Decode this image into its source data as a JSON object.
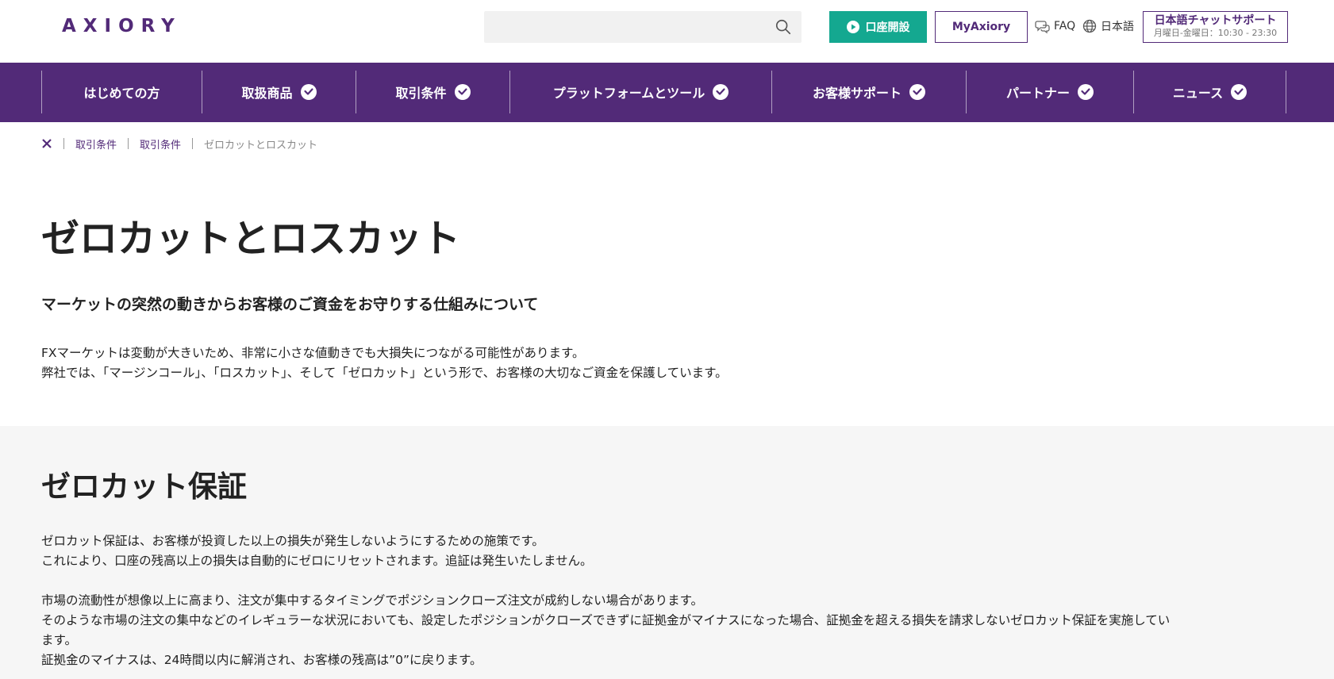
{
  "header": {
    "logo_text": "AXIORY",
    "search": {
      "value": "",
      "placeholder": ""
    },
    "open_account_label": "口座開設",
    "my_axiory_label": "MyAxiory",
    "faq_label": "FAQ",
    "language_label": "日本語",
    "chat": {
      "title": "日本語チャットサポート",
      "hours": "月曜日-金曜日：10:30 - 23:30"
    }
  },
  "nav": {
    "items": [
      {
        "label": "はじめての方",
        "has_dropdown": false
      },
      {
        "label": "取扱商品",
        "has_dropdown": true
      },
      {
        "label": "取引条件",
        "has_dropdown": true
      },
      {
        "label": "プラットフォームとツール",
        "has_dropdown": true
      },
      {
        "label": "お客様サポート",
        "has_dropdown": true
      },
      {
        "label": "パートナー",
        "has_dropdown": true
      },
      {
        "label": "ニュース",
        "has_dropdown": true
      }
    ]
  },
  "breadcrumb": {
    "items": [
      "取引条件",
      "取引条件"
    ],
    "current": "ゼロカットとロスカット"
  },
  "main": {
    "title": "ゼロカットとロスカット",
    "subtitle": "マーケットの突然の動きからお客様のご資金をお守りする仕組みについて",
    "intro": [
      "FXマーケットは変動が大きいため、非常に小さな値動きでも大損失につながる可能性があります。",
      "弊社では、「マージンコール」、「ロスカット」、そして「ゼロカット」という形で、お客様の大切なご資金を保護しています。"
    ]
  },
  "section": {
    "title": "ゼロカット保証",
    "paragraph1": [
      "ゼロカット保証は、お客様が投資した以上の損失が発生しないようにするための施策です。",
      "これにより、口座の残高以上の損失は自動的にゼロにリセットされます。追証は発生いたしません。"
    ],
    "paragraph2": [
      "市場の流動性が想像以上に高まり、注文が集中するタイミングでポジションクローズ注文が成約しない場合があります。",
      "そのような市場の注文の集中などのイレギュラーな状況においても、設定したポジションがクローズできずに証拠金がマイナスになった場合、証拠金を超える損失を請求しないゼロカット保証を実施してい",
      "ます。",
      "証拠金のマイナスは、24時間以内に解消され、お客様の残高は”0”に戻ります。"
    ]
  },
  "colors": {
    "brand_purple": "#522a78",
    "accent_green": "#14a890",
    "section_grey": "#f6f6f6"
  },
  "icons": [
    "search-icon",
    "play-icon",
    "faq-icon",
    "globe-icon",
    "chevron-down-icon",
    "home-logo-icon"
  ]
}
